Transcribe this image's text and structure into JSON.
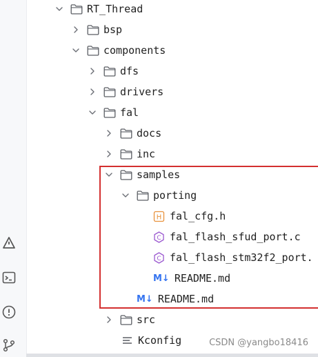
{
  "tree": {
    "root": {
      "label": "RT_Thread"
    },
    "bsp": {
      "label": "bsp"
    },
    "components": {
      "label": "components"
    },
    "dfs": {
      "label": "dfs"
    },
    "drivers": {
      "label": "drivers"
    },
    "fal": {
      "label": "fal"
    },
    "docs": {
      "label": "docs"
    },
    "inc": {
      "label": "inc"
    },
    "samples": {
      "label": "samples"
    },
    "porting": {
      "label": "porting"
    },
    "fal_cfg": {
      "label": "fal_cfg.h",
      "icon_letter": "H"
    },
    "sfud_port": {
      "label": "fal_flash_sfud_port.c",
      "icon_letter": "C"
    },
    "stm32_port": {
      "label": "fal_flash_stm32f2_port.",
      "icon_letter": "C"
    },
    "readme_porting": {
      "label": "README.md",
      "icon_text": "M↓"
    },
    "readme_samples": {
      "label": "README.md",
      "icon_text": "M↓"
    },
    "src": {
      "label": "src"
    },
    "kconfig": {
      "label": "Kconfig"
    }
  },
  "watermark": {
    "text": "CSDN @yangbo18416"
  },
  "colors": {
    "highlight_border": "#d32f2f",
    "h_file_icon": "#e8913a",
    "c_file_icon": "#9b59d0",
    "markdown_icon": "#3574f0"
  },
  "tool_icons": [
    "build-icon",
    "terminal-icon",
    "problems-icon",
    "git-icon"
  ]
}
